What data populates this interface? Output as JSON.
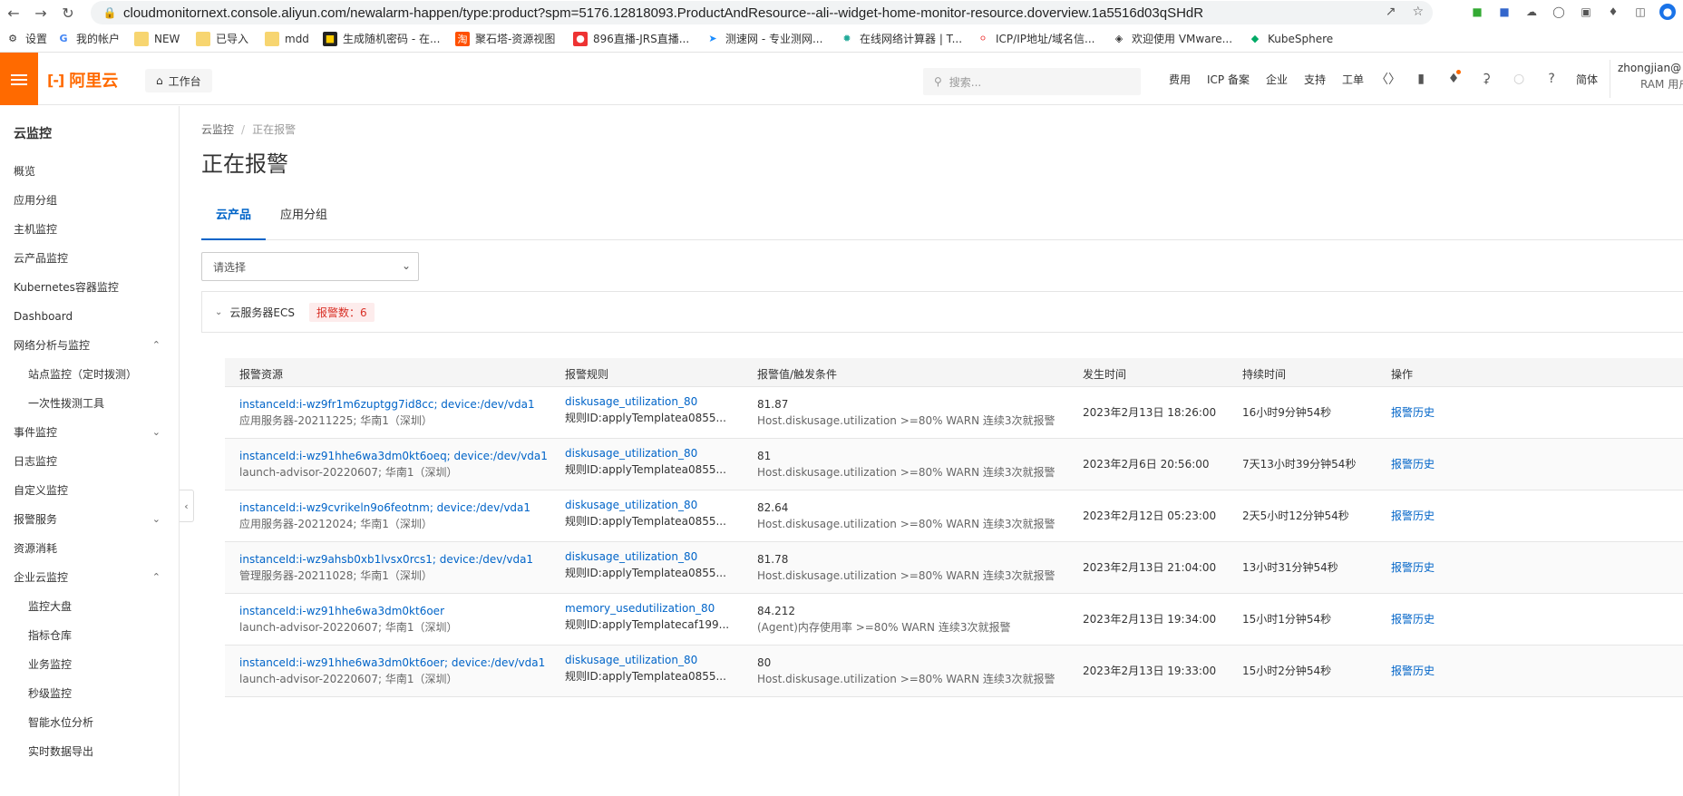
{
  "browser": {
    "url": "cloudmonitornext.console.aliyun.com/newalarm-happen/type:product?spm=5176.12818093.ProductAndResource--ali--widget-home-monitor-resource.doverview.1a5516d03qSHdR"
  },
  "bookmarks": [
    {
      "label": "设置",
      "icon": "gear-icon"
    },
    {
      "label": "我的帐户",
      "icon": "google-icon"
    },
    {
      "label": "NEW",
      "icon": "folder-icon"
    },
    {
      "label": "已导入",
      "icon": "folder-icon"
    },
    {
      "label": "mdd",
      "icon": "folder-icon"
    },
    {
      "label": "生成随机密码 - 在...",
      "icon": "site-icon"
    },
    {
      "label": "聚石塔-资源视图",
      "icon": "taobao-icon"
    },
    {
      "label": "896直播-JRS直播...",
      "icon": "site-icon"
    },
    {
      "label": "测速网 - 专业测网...",
      "icon": "site-icon"
    },
    {
      "label": "在线网络计算器 | T...",
      "icon": "site-icon"
    },
    {
      "label": "ICP/IP地址/域名信...",
      "icon": "site-icon"
    },
    {
      "label": "欢迎使用 VMware...",
      "icon": "site-icon"
    },
    {
      "label": "KubeSphere",
      "icon": "site-icon"
    }
  ],
  "topbar": {
    "brand": "阿里云",
    "workbench": "工作台",
    "search_placeholder": "搜索...",
    "nav": [
      "费用",
      "ICP 备案",
      "企业",
      "支持",
      "工单"
    ],
    "lang": "简体",
    "user": "zhongjian@",
    "user_sub": "RAM 用户"
  },
  "sidebar": {
    "title": "云监控",
    "items": [
      {
        "label": "概览"
      },
      {
        "label": "应用分组"
      },
      {
        "label": "主机监控"
      },
      {
        "label": "云产品监控"
      },
      {
        "label": "Kubernetes容器监控"
      },
      {
        "label": "Dashboard"
      },
      {
        "label": "网络分析与监控"
      },
      {
        "label": "站点监控（定时拨测）"
      },
      {
        "label": "一次性拨测工具"
      },
      {
        "label": "事件监控"
      },
      {
        "label": "日志监控"
      },
      {
        "label": "自定义监控"
      },
      {
        "label": "报警服务"
      },
      {
        "label": "资源消耗"
      },
      {
        "label": "企业云监控"
      },
      {
        "label": "监控大盘"
      },
      {
        "label": "指标仓库"
      },
      {
        "label": "业务监控"
      },
      {
        "label": "秒级监控"
      },
      {
        "label": "智能水位分析"
      },
      {
        "label": "实时数据导出"
      }
    ]
  },
  "main": {
    "breadcrumb": [
      "云监控",
      "正在报警"
    ],
    "title": "正在报警",
    "tabs": [
      "云产品",
      "应用分组"
    ],
    "select_placeholder": "请选择",
    "group": {
      "name": "云服务器ECS",
      "badge": "报警数：6"
    },
    "columns": [
      "报警资源",
      "报警规则",
      "报警值/触发条件",
      "发生时间",
      "持续时间",
      "操作"
    ],
    "rows": [
      {
        "resource": "instanceId:i-wz9fr1m6zuptgg7id8cc; device:/dev/vda1",
        "resource_sub": "应用服务器-20211225; 华南1（深圳）",
        "rule": "diskusage_utilization_80",
        "rule_sub": "规则ID:applyTemplatea0855...",
        "value": "81.87",
        "cond": "Host.diskusage.utilization >=80% WARN 连续3次就报警",
        "time": "2023年2月13日 18:26:00",
        "duration": "16小时9分钟54秒",
        "action": "报警历史"
      },
      {
        "resource": "instanceId:i-wz91hhe6wa3dm0kt6oeq; device:/dev/vda1",
        "resource_sub": "launch-advisor-20220607; 华南1（深圳）",
        "rule": "diskusage_utilization_80",
        "rule_sub": "规则ID:applyTemplatea0855...",
        "value": "81",
        "cond": "Host.diskusage.utilization >=80% WARN 连续3次就报警",
        "time": "2023年2月6日 20:56:00",
        "duration": "7天13小时39分钟54秒",
        "action": "报警历史"
      },
      {
        "resource": "instanceId:i-wz9cvrikeln9o6feotnm; device:/dev/vda1",
        "resource_sub": "应用服务器-20212024; 华南1（深圳）",
        "rule": "diskusage_utilization_80",
        "rule_sub": "规则ID:applyTemplatea0855...",
        "value": "82.64",
        "cond": "Host.diskusage.utilization >=80% WARN 连续3次就报警",
        "time": "2023年2月12日 05:23:00",
        "duration": "2天5小时12分钟54秒",
        "action": "报警历史"
      },
      {
        "resource": "instanceId:i-wz9ahsb0xb1lvsx0rcs1; device:/dev/vda1",
        "resource_sub": "管理服务器-20211028; 华南1（深圳）",
        "rule": "diskusage_utilization_80",
        "rule_sub": "规则ID:applyTemplatea0855...",
        "value": "81.78",
        "cond": "Host.diskusage.utilization >=80% WARN 连续3次就报警",
        "time": "2023年2月13日 21:04:00",
        "duration": "13小时31分钟54秒",
        "action": "报警历史"
      },
      {
        "resource": "instanceId:i-wz91hhe6wa3dm0kt6oer",
        "resource_sub": "launch-advisor-20220607; 华南1（深圳）",
        "rule": "memory_usedutilization_80",
        "rule_sub": "规则ID:applyTemplatecaf199...",
        "value": "84.212",
        "cond": "(Agent)内存使用率 >=80% WARN 连续3次就报警",
        "time": "2023年2月13日 19:34:00",
        "duration": "15小时1分钟54秒",
        "action": "报警历史"
      },
      {
        "resource": "instanceId:i-wz91hhe6wa3dm0kt6oer; device:/dev/vda1",
        "resource_sub": "launch-advisor-20220607; 华南1（深圳）",
        "rule": "diskusage_utilization_80",
        "rule_sub": "规则ID:applyTemplatea0855...",
        "value": "80",
        "cond": "Host.diskusage.utilization >=80% WARN 连续3次就报警",
        "time": "2023年2月13日 19:33:00",
        "duration": "15小时2分钟54秒",
        "action": "报警历史"
      }
    ]
  },
  "colors": {
    "brand": "#ff6a00",
    "link": "#0064c8",
    "alarm": "#d93026"
  }
}
